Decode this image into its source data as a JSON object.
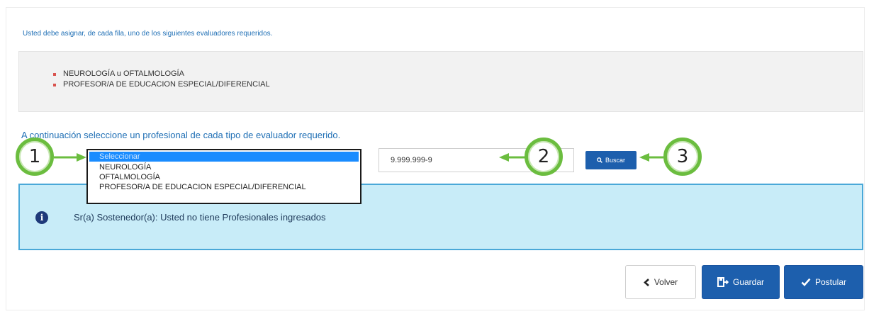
{
  "intro_text": "Usted debe asignar, de cada fila, uno de los siguientes evaluadores requeridos.",
  "required_evaluators": [
    "NEUROLOGÍA u OFTALMOLOGÍA",
    "PROFESOR/A DE EDUCACION ESPECIAL/DIFERENCIAL"
  ],
  "instruction": "A continuación seleccione un profesional de cada tipo de evaluador requerido.",
  "dropdown": {
    "options": [
      "Seleccionar",
      "NEUROLOGÍA",
      "OFTALMOLOGÍA",
      "PROFESOR/A DE EDUCACION ESPECIAL/DIFERENCIAL"
    ],
    "selected_index": 0
  },
  "rut_input": {
    "value": "9.999.999-9"
  },
  "buscar_label": "Buscar",
  "info_message": "Sr(a) Sostenedor(a): Usted no tiene Profesionales ingresados",
  "buttons": {
    "volver": "Volver",
    "guardar": "Guardar",
    "postular": "Postular"
  },
  "callouts": [
    "1",
    "2",
    "3"
  ],
  "colors": {
    "primary": "#1d5fad",
    "link_text": "#1f6fb5",
    "info_bg": "#c8ecf8",
    "info_border": "#4aa8d8",
    "callout_green": "#6bbd3f",
    "bullet_red": "#d9534f"
  },
  "icons": {
    "info": "info-circle-icon",
    "search": "search-icon",
    "back": "chevron-left-icon",
    "save": "save-icon",
    "submit": "check-icon"
  }
}
